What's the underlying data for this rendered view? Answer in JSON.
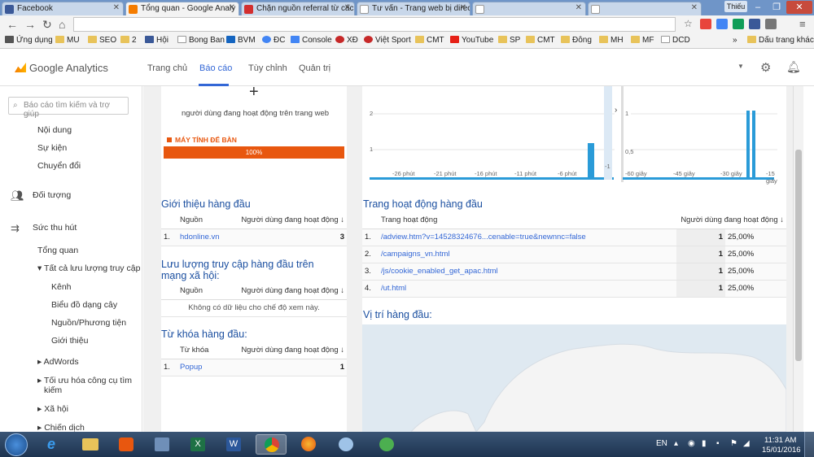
{
  "tabs": [
    {
      "label": "Facebook",
      "color": "#3b5998"
    },
    {
      "label": "Tổng quan - Google Analy",
      "color": "#f57c00"
    },
    {
      "label": "Chặn nguồn referral từ các",
      "color": "#d32f2f"
    },
    {
      "label": "Tư vấn - Trang web bị direc",
      "color": "#ffffff"
    },
    {
      "label": "",
      "color": "#ffffff"
    }
  ],
  "window": {
    "user_badge": "Thiếu"
  },
  "bookmarks": [
    "Ứng dụng",
    "MU",
    "SEO",
    "2",
    "Hội",
    "Bong Ban",
    "BVM",
    "ĐC",
    "Console",
    "XĐ",
    "Việt Sport",
    "CMT",
    "YouTube",
    "SP",
    "CMT",
    "Đông",
    "MH",
    "MF",
    "DCD",
    "»",
    "Dấu trang khác"
  ],
  "ga": {
    "logo": "Google Analytics",
    "nav": [
      "Trang chủ",
      "Báo cáo",
      "Tùy chỉnh",
      "Quản trị"
    ],
    "active_nav": "Báo cáo"
  },
  "sidebar": {
    "search_placeholder": "Báo cáo tìm kiếm và trợ giúp",
    "items": [
      "Nội dung",
      "Sự kiện",
      "Chuyển đổi",
      "Đối tượng",
      "Sức thu hút",
      "Tổng quan",
      "▾ Tất cả lưu lượng truy cập",
      "Kênh",
      "Biểu đồ dạng cây",
      "Nguồn/Phương tiện",
      "Giới thiệu",
      "▸ AdWords",
      "▸ Tối ưu hóa công cụ tìm",
      "kiếm",
      "▸ Xã hội",
      "▸ Chiến dịch"
    ]
  },
  "realtime": {
    "subtitle": "người dùng đang hoạt động trên trang web",
    "device_label": "MÁY TÍNH ĐỂ BÀN",
    "device_percent": "100%",
    "chart_min_ticks": [
      "-26 phút",
      "-21 phút",
      "-16 phút",
      "-11 phút",
      "-6 phút",
      "-1"
    ],
    "chart_min_y": [
      "2",
      "1"
    ],
    "chart_sec_ticks": [
      "-60 giây",
      "-45 giây",
      "-30 giây",
      "-15 giây"
    ],
    "chart_sec_y": [
      "1",
      "0,5"
    ]
  },
  "referrals": {
    "title": "Giới thiệu hàng đầu",
    "headers": [
      "Nguồn",
      "Người dùng đang hoạt động"
    ],
    "rows": [
      {
        "idx": "1.",
        "name": "hdonline.vn",
        "value": "3"
      }
    ]
  },
  "social": {
    "title_line1": "Lưu lượng truy cập hàng đầu trên",
    "title_line2": "mạng xã hội:",
    "headers": [
      "Nguồn",
      "Người dùng đang hoạt động"
    ],
    "empty": "Không có dữ liệu cho chế độ xem này."
  },
  "keywords": {
    "title": "Từ khóa hàng đầu:",
    "headers": [
      "Từ khóa",
      "Người dùng đang hoạt động"
    ],
    "rows": [
      {
        "idx": "1.",
        "name": "Popup",
        "value": "1"
      }
    ]
  },
  "pages": {
    "title": "Trang hoạt động hàng đầu",
    "headers": [
      "Trang hoạt động",
      "Người dùng đang hoạt động"
    ],
    "rows": [
      {
        "idx": "1.",
        "name": "/adview.htm?v=14528324676...cenable=true&newnnc=false",
        "value": "1",
        "pct": "25,00%"
      },
      {
        "idx": "2.",
        "name": "/campaigns_vn.html",
        "value": "1",
        "pct": "25,00%"
      },
      {
        "idx": "3.",
        "name": "/js/cookie_enabled_get_apac.html",
        "value": "1",
        "pct": "25,00%"
      },
      {
        "idx": "4.",
        "name": "/ut.html",
        "value": "1",
        "pct": "25,00%"
      }
    ]
  },
  "locations": {
    "title": "Vị trí hàng đầu:"
  },
  "taskbar": {
    "lang": "EN",
    "time": "11:31 AM",
    "date": "15/01/2016"
  }
}
